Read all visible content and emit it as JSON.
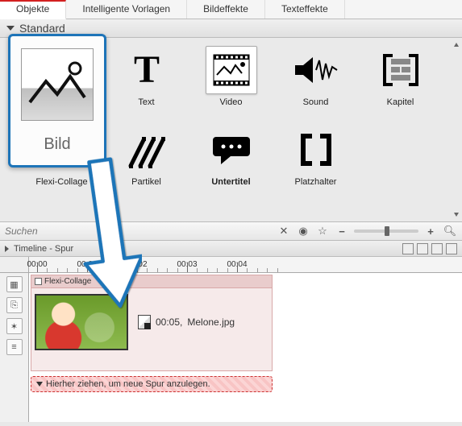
{
  "tabs": {
    "objects": "Objekte",
    "templates": "Intelligente Vorlagen",
    "image_fx": "Bildeffekte",
    "text_fx": "Texteffekte"
  },
  "category": {
    "label": "Standard"
  },
  "objects": {
    "bild": "Bild",
    "text": "Text",
    "video": "Video",
    "sound": "Sound",
    "kapitel": "Kapitel",
    "flexicollage": "Flexi-Collage",
    "partikel": "Partikel",
    "untertitel": "Untertitel",
    "platzhalter": "Platzhalter"
  },
  "search": {
    "placeholder": "Suchen"
  },
  "timeline": {
    "title": "Timeline - Spur",
    "ticks": [
      "00:00",
      "00:01",
      "00:02",
      "00:03",
      "00:04"
    ],
    "clip_container_label": "Flexi-Collage",
    "clip_time": "00:05,",
    "clip_filename": "Melone.jpg",
    "drop_hint": "Hierher ziehen, um neue Spur anzulegen."
  },
  "highlight": {
    "label": "Bild"
  }
}
